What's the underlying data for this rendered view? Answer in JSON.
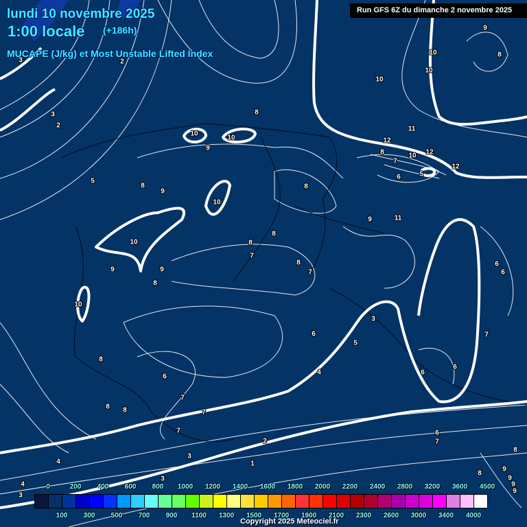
{
  "header": {
    "date": "lundi 10 novembre 2025",
    "time": "1:00 locale",
    "lead": "(+186h)",
    "parameter": "MUCAPE (J/kg) et Most Unstable Lifted Index",
    "run": "Run GFS 6Z du dimanche 2 novembre 2025"
  },
  "contour_labels": [
    "3",
    "2",
    "3",
    "2",
    "9",
    "8",
    "10",
    "10",
    "10",
    "8",
    "11",
    "10",
    "10",
    "9",
    "12",
    "8",
    "10",
    "12",
    "7",
    "12",
    "6",
    "5",
    "5",
    "8",
    "9",
    "8",
    "10",
    "9",
    "11",
    "8",
    "8",
    "10",
    "7",
    "8",
    "9",
    "9",
    "7",
    "6",
    "6",
    "8",
    "10",
    "3",
    "6",
    "5",
    "7",
    "8",
    "6",
    "6",
    "4",
    "6",
    "7",
    "8",
    "8",
    "7",
    "7",
    "6",
    "7",
    "2",
    "8",
    "3",
    "4",
    "1",
    "8",
    "9",
    "9",
    "9",
    "9",
    "3",
    "4",
    "3"
  ],
  "legend": {
    "unit": "J/kg",
    "colors": [
      "#0a1540",
      "#06306a",
      "#003399",
      "#0000cc",
      "#0000ff",
      "#0033ff",
      "#0099ff",
      "#33ccff",
      "#66ffff",
      "#66ff99",
      "#66ff66",
      "#66ff00",
      "#ccf01a",
      "#ffff00",
      "#ffff80",
      "#ffe040",
      "#ffcc00",
      "#ff9900",
      "#ff6600",
      "#ff3333",
      "#ff3300",
      "#ff0000",
      "#dd0000",
      "#b30000",
      "#b00030",
      "#b00070",
      "#aa00aa",
      "#cc00cc",
      "#dd00dd",
      "#ff00ff",
      "#e080e0",
      "#ffc0ff",
      "#ffffff"
    ],
    "top_ticks": [
      "0",
      "200",
      "400",
      "600",
      "800",
      "1000",
      "1200",
      "1400",
      "1600",
      "1800",
      "2000",
      "2200",
      "2400",
      "2800",
      "3200",
      "3600",
      "4500"
    ],
    "bottom_ticks": [
      "100",
      "300",
      "500",
      "700",
      "900",
      "1100",
      "1300",
      "1500",
      "1700",
      "1900",
      "2100",
      "2300",
      "2600",
      "3000",
      "3400",
      "4000"
    ]
  },
  "copyright": "Copyright 2025 Meteociel.fr"
}
